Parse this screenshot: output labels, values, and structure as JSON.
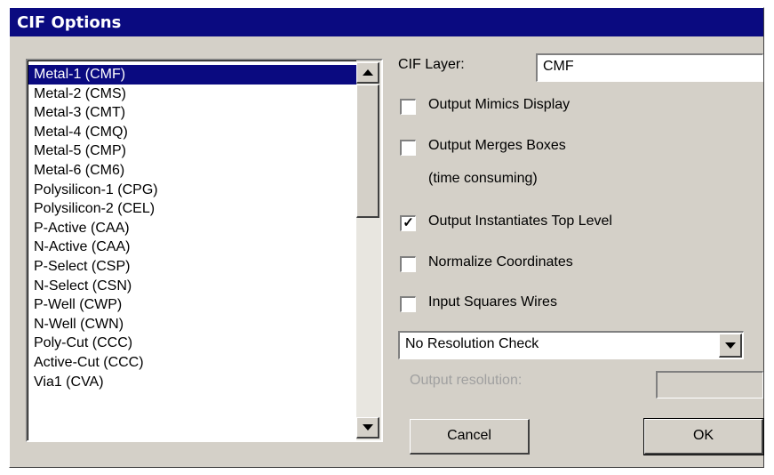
{
  "dialog": {
    "title": "CIF Options"
  },
  "layers": [
    "Metal-1 (CMF)",
    "Metal-2 (CMS)",
    "Metal-3 (CMT)",
    "Metal-4 (CMQ)",
    "Metal-5 (CMP)",
    "Metal-6 (CM6)",
    "Polysilicon-1 (CPG)",
    "Polysilicon-2 (CEL)",
    "P-Active (CAA)",
    "N-Active (CAA)",
    "P-Select (CSP)",
    "N-Select (CSN)",
    "P-Well (CWP)",
    "N-Well (CWN)",
    "Poly-Cut (CCC)",
    "Active-Cut (CCC)",
    "Via1 (CVA)"
  ],
  "selected_layer": "Metal-1 (CMF)",
  "cif_layer": {
    "label": "CIF Layer:",
    "value": "CMF"
  },
  "options": {
    "mimics": {
      "label": "Output Mimics Display",
      "checked": false
    },
    "merges": {
      "label": "Output Merges Boxes",
      "note": "(time consuming)",
      "checked": false
    },
    "instantiates": {
      "label": "Output Instantiates Top Level",
      "checked": true,
      "mark": "✓"
    },
    "normalize": {
      "label": "Normalize Coordinates",
      "checked": false
    },
    "squares": {
      "label": "Input Squares Wires",
      "checked": false
    }
  },
  "resolution": {
    "selected": "No Resolution Check",
    "output_label": "Output resolution:",
    "output_value": ""
  },
  "buttons": {
    "cancel": "Cancel",
    "ok": "OK"
  }
}
